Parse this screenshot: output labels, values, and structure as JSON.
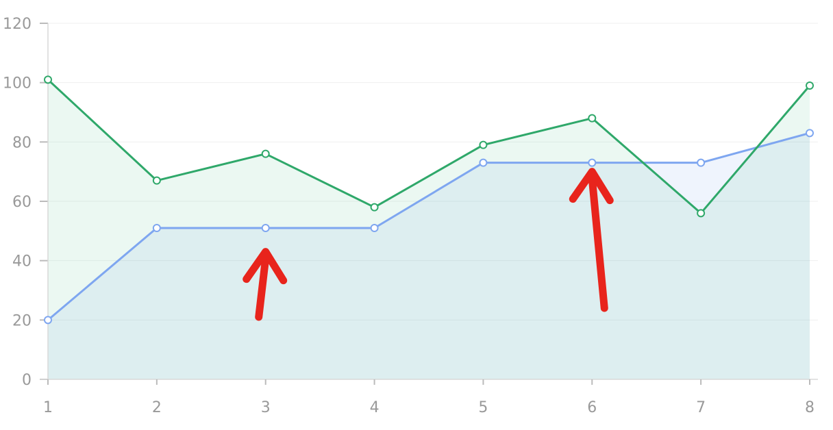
{
  "chart_data": {
    "type": "area",
    "x": [
      1,
      2,
      3,
      4,
      5,
      6,
      7,
      8
    ],
    "x_tick_labels": [
      "1",
      "2",
      "3",
      "4",
      "5",
      "6",
      "7",
      "8"
    ],
    "y_tick_labels": [
      "0",
      "20",
      "40",
      "60",
      "80",
      "100",
      "120"
    ],
    "y_ticks": [
      0,
      20,
      40,
      60,
      80,
      100,
      120
    ],
    "ylim": [
      0,
      120
    ],
    "xlim": [
      1,
      8
    ],
    "grid": true,
    "series": [
      {
        "values": [
          20,
          51,
          51,
          51,
          73,
          73,
          73,
          83
        ],
        "line_color": "#7ea6f0",
        "fill_color": "#7ea6f0"
      },
      {
        "values": [
          101,
          67,
          76,
          58,
          79,
          88,
          56,
          99
        ],
        "line_color": "#2fa86a",
        "fill_color": "#5cc990"
      }
    ]
  },
  "annotations": [
    {
      "icon": "arrow-up-icon",
      "color": "#e8241c",
      "x": 3,
      "y_from": 21,
      "y_to": 43
    },
    {
      "icon": "arrow-up-icon",
      "color": "#e8241c",
      "x": 6,
      "y_from": 24,
      "y_to": 70
    }
  ]
}
